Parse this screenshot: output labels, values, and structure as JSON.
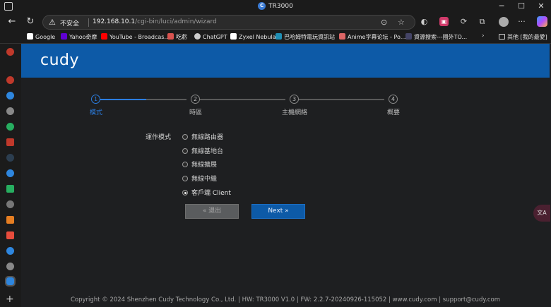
{
  "browser": {
    "tab_title": "TR3000",
    "tab_icon_letter": "C",
    "insecure_label": "不安全",
    "url_host": "192.168.10.1",
    "url_path": "/cgi-bin/luci/admin/wizard"
  },
  "bookmarks": [
    {
      "label": "Google",
      "color": "#ffffff"
    },
    {
      "label": "Yahoo奇摩",
      "color": "#6001d2"
    },
    {
      "label": "YouTube - Broadcas...",
      "color": "#ff0000"
    },
    {
      "label": "吃虧",
      "color": "#d9534f"
    },
    {
      "label": "ChatGPT",
      "color": "#cccccc"
    },
    {
      "label": "Zyxel Nebula",
      "color": "#ffffff"
    },
    {
      "label": "巴哈姆特電玩資訊站",
      "color": "#1f8fb5"
    },
    {
      "label": "Anime字幕论坛 - Po...",
      "color": "#d66"
    },
    {
      "label": "資源搜索---國外TO...",
      "color": "#446"
    }
  ],
  "bookmarks_other": "其他 [我的最愛]",
  "page": {
    "logo": "cudy",
    "steps": [
      {
        "number": "1",
        "label": "模式",
        "active": true
      },
      {
        "number": "2",
        "label": "時區",
        "active": false
      },
      {
        "number": "3",
        "label": "主機網絡",
        "active": false
      },
      {
        "number": "4",
        "label": "概要",
        "active": false
      }
    ],
    "mode_label": "運作模式",
    "options": [
      {
        "label": "無線路由器",
        "checked": false
      },
      {
        "label": "無線基地台",
        "checked": false
      },
      {
        "label": "無線擴展",
        "checked": false
      },
      {
        "label": "無線中繼",
        "checked": false
      },
      {
        "label": "客戶端 Client",
        "checked": true
      }
    ],
    "back_button": "« 退出",
    "next_button": "Next »",
    "footer": "Copyright © 2024 Shenzhen Cudy Technology Co., Ltd.  |  HW: TR3000 V1.0  |  FW: 2.2.7-20240926-115052  |  www.cudy.com  |  support@cudy.com"
  }
}
